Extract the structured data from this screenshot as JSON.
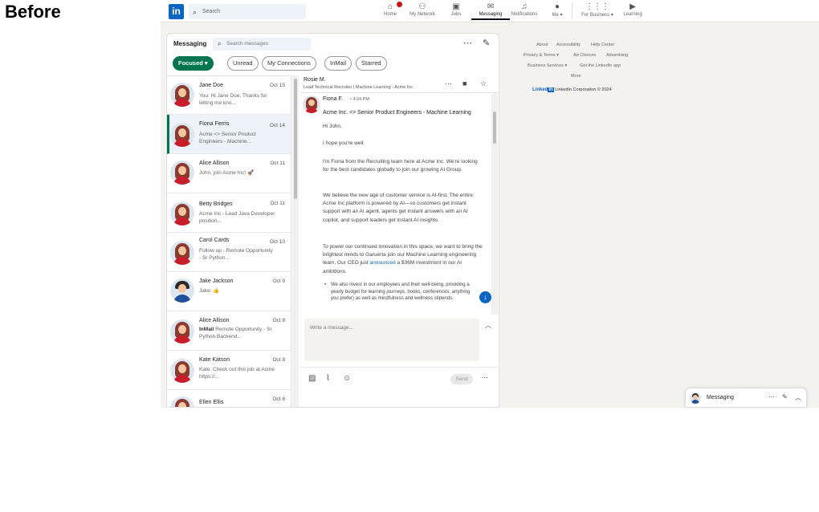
{
  "header_label": "Before",
  "colors": {
    "brand": "#0a66c2",
    "focused_pill": "#01754f",
    "notification": "#cc1016",
    "page_bg": "#f4f2ee"
  },
  "nav": {
    "logo": "in",
    "search_placeholder": "Search",
    "items": [
      {
        "label": "Home",
        "icon": "home-icon"
      },
      {
        "label": "My Network",
        "icon": "network-icon"
      },
      {
        "label": "Jobs",
        "icon": "briefcase-icon"
      },
      {
        "label": "Messaging",
        "icon": "messaging-icon"
      },
      {
        "label": "Notifications",
        "icon": "bell-icon"
      },
      {
        "label": "Me ▾",
        "icon": "avatar-icon"
      },
      {
        "label": "For Business ▾",
        "icon": "grid-icon"
      },
      {
        "label": "Learning",
        "icon": "play-icon"
      }
    ]
  },
  "messaging": {
    "title": "Messaging",
    "search_placeholder": "Search messages",
    "filters": [
      "Focused ▾",
      "Unread",
      "My Connections",
      "InMail",
      "Starred"
    ],
    "conversations": [
      {
        "name": "Jane Doe",
        "date": "Oct 15",
        "snippet": "You: Hi Jane Doe, Thanks for letting me kno..."
      },
      {
        "name": "Fiona Ferris",
        "date": "Oct 14",
        "snippet": "Acme <> Senior Product Engineers - Machine..."
      },
      {
        "name": "Alice Allison",
        "date": "Oct 11",
        "snippet": "John, join Acme Inc! 🚀"
      },
      {
        "name": "Betty Bridges",
        "date": "Oct 11",
        "snippet": "Acme Inc - Lead Java Developer position..."
      },
      {
        "name": "Carol Cards",
        "date": "Oct 10",
        "snippet": "Follow up - Remote Opportunity - Sr Python..."
      },
      {
        "name": "Jake Jackson",
        "date": "Oct 9",
        "snippet": "Jake: 👍"
      },
      {
        "name": "Alice Allison",
        "date": "Oct 8",
        "inmail": "InMail",
        "snippet": "Remote Opportunity - Sr Python Backend..."
      },
      {
        "name": "Kate Katson",
        "date": "Oct 8",
        "snippet": "Kate: Check out this job at Acme https://..."
      },
      {
        "name": "Ellen Ellis",
        "date": "Oct 8",
        "snippet": ""
      }
    ],
    "thread": {
      "contact_name": "Rosie M.",
      "contact_role": "Lead Technical Recruiter | Machine Learning · Acme Inc",
      "sender": "Fiona F.",
      "time": "• 4:24 PM",
      "subject": "Acme Inc. <> Senior Product Engineers - Machine Learning",
      "greeting": "Hi John,",
      "p1": "I hope you're well.",
      "p2": "I'm Fiona from the Recruiting team here at Acme Inc. We're looking for the best candidates globally to join our growing AI Group.",
      "p3": "We believe the new age of customer service is AI-first. The entire Acme Inc platform is powered by AI—so customers get instant support with an AI agent, agents get instant answers with an AI copilot, and support leaders get instant AI insights.",
      "p4_pre": "To power our continued innovation in this space, we want to bring the brightest minds to Garuerta join our Machine Learning engineering team. Our CEO just ",
      "p4_link": "announced",
      "p4_post": " a $36M investment in our AI ambitions.",
      "bullet": "We also invest in our employees and their well-being, providing a yearly budget for learning journeys, books, conferences, anything you prefer) as well as mindfulness and wellness stipends."
    },
    "compose_placeholder": "Write a message...",
    "send_label": "Send"
  },
  "footer": {
    "links_row1": [
      "About",
      "Accessibility",
      "Help Center"
    ],
    "links_row2": [
      "Privacy & Terms ▾",
      "Ad Choices",
      "Advertising"
    ],
    "links_row3": [
      "Business Services ▾",
      "Get the LinkedIn app"
    ],
    "more": "More",
    "brand": "Linked",
    "copyright": "LinkedIn Corporation © 2024"
  },
  "mini_messaging_label": "Messaging"
}
